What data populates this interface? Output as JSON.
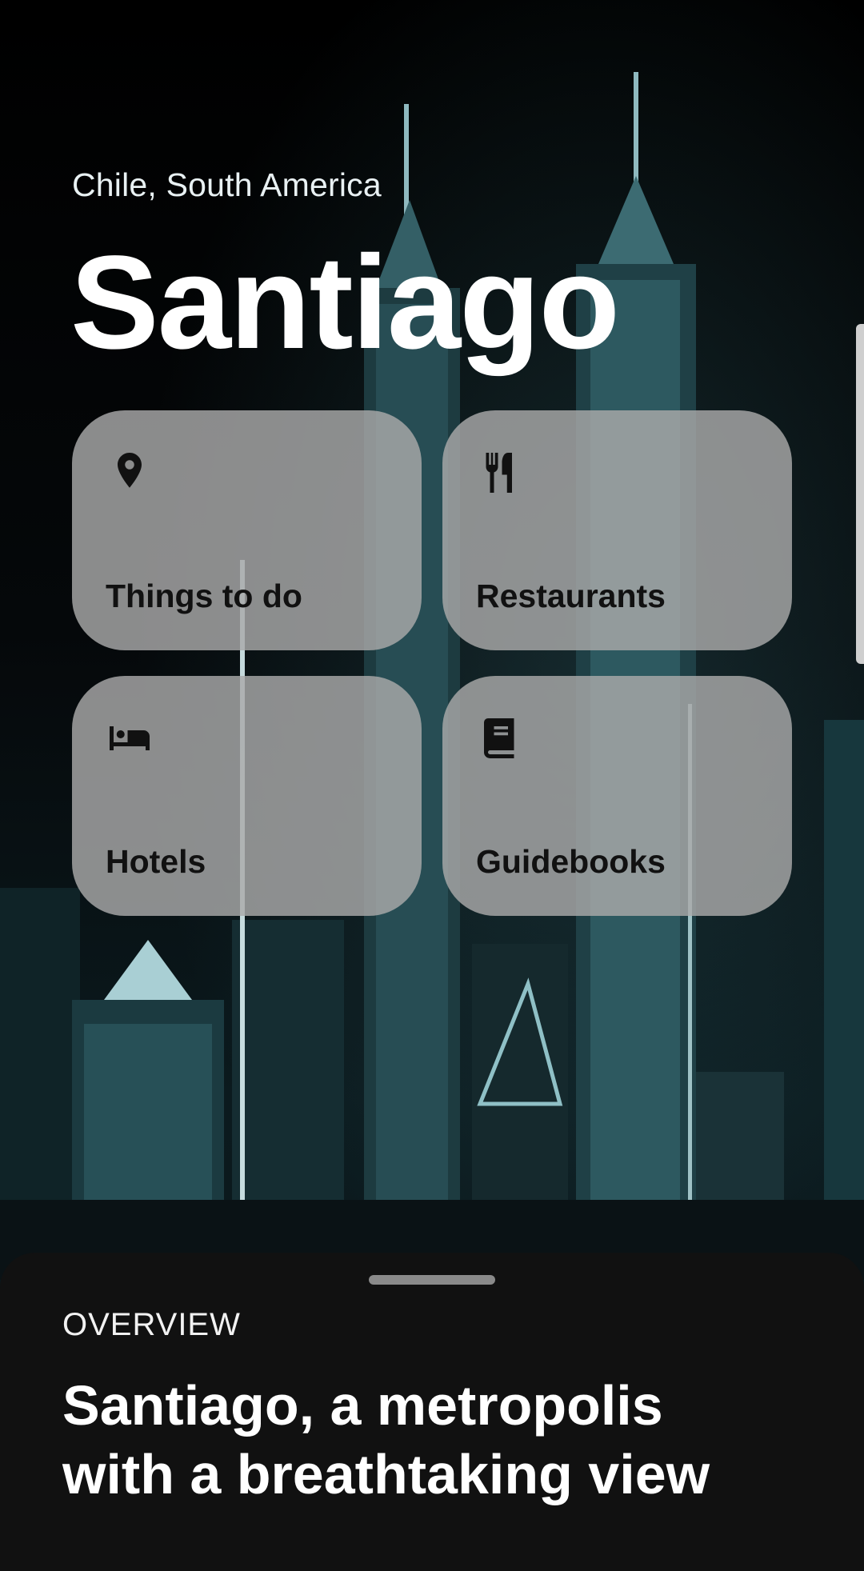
{
  "header": {
    "location": "Chile, South America",
    "city": "Santiago"
  },
  "tiles": [
    {
      "label": "Things to do",
      "icon": "location-pin-icon"
    },
    {
      "label": "Restaurants",
      "icon": "fork-knife-icon"
    },
    {
      "label": "Hotels",
      "icon": "bed-icon"
    },
    {
      "label": "Guidebooks",
      "icon": "book-icon"
    }
  ],
  "sheet": {
    "kicker": "OVERVIEW",
    "title": "Santiago, a metropolis with a breathtaking view"
  }
}
